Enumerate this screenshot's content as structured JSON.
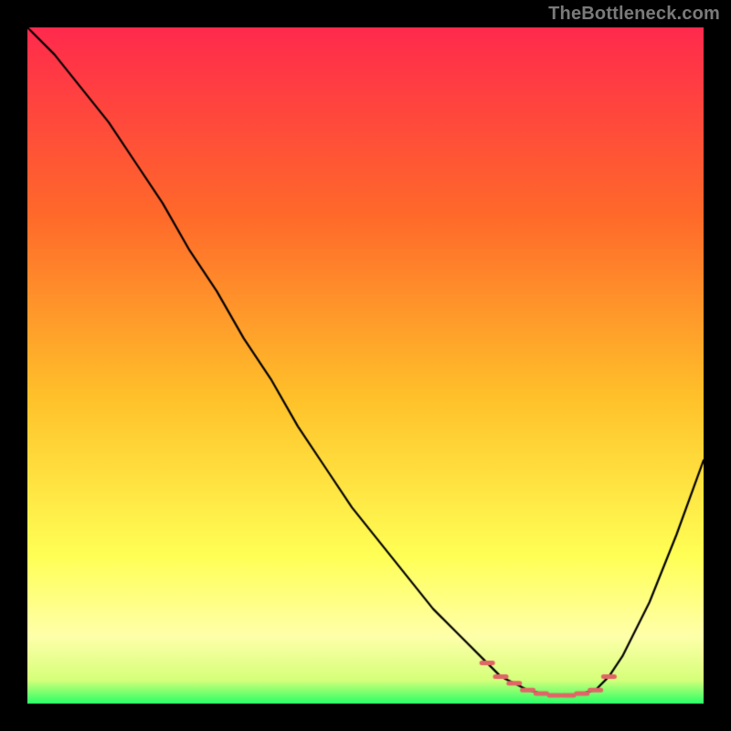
{
  "attribution": "TheBottleneck.com",
  "colors": {
    "page_bg": "#000000",
    "gradient_top": "#ff2a4d",
    "gradient_mid1": "#ff7a2a",
    "gradient_mid2": "#ffd22a",
    "gradient_mid3": "#ffff66",
    "gradient_bottom": "#2aff66",
    "curve": "#000000",
    "marker": "#e06666"
  },
  "chart_data": {
    "type": "line",
    "title": "",
    "xlabel": "",
    "ylabel": "",
    "xlim": [
      0,
      100
    ],
    "ylim": [
      0,
      100
    ],
    "series": [
      {
        "name": "bottleneck-curve",
        "x": [
          0,
          4,
          8,
          12,
          16,
          20,
          24,
          28,
          32,
          36,
          40,
          44,
          48,
          52,
          56,
          60,
          64,
          68,
          70,
          72,
          74,
          76,
          78,
          80,
          82,
          84,
          86,
          88,
          92,
          96,
          100
        ],
        "y": [
          100,
          96,
          91,
          86,
          80,
          74,
          67,
          61,
          54,
          48,
          41,
          35,
          29,
          24,
          19,
          14,
          10,
          6,
          4,
          3,
          2,
          1.5,
          1.2,
          1.2,
          1.5,
          2,
          4,
          7,
          15,
          25,
          36
        ]
      }
    ],
    "markers": {
      "name": "optimal-range-markers",
      "x": [
        68,
        70,
        72,
        74,
        76,
        78,
        80,
        82,
        84,
        86
      ],
      "y": [
        6,
        4,
        3,
        2,
        1.5,
        1.2,
        1.2,
        1.5,
        2,
        4
      ]
    },
    "gradient_stops": [
      {
        "offset": 0.0,
        "color": "#ff2a4d"
      },
      {
        "offset": 0.28,
        "color": "#ff6a2a"
      },
      {
        "offset": 0.55,
        "color": "#ffc22a"
      },
      {
        "offset": 0.78,
        "color": "#ffff55"
      },
      {
        "offset": 0.9,
        "color": "#ffffaa"
      },
      {
        "offset": 0.965,
        "color": "#d6ff7a"
      },
      {
        "offset": 1.0,
        "color": "#2aff66"
      }
    ]
  }
}
